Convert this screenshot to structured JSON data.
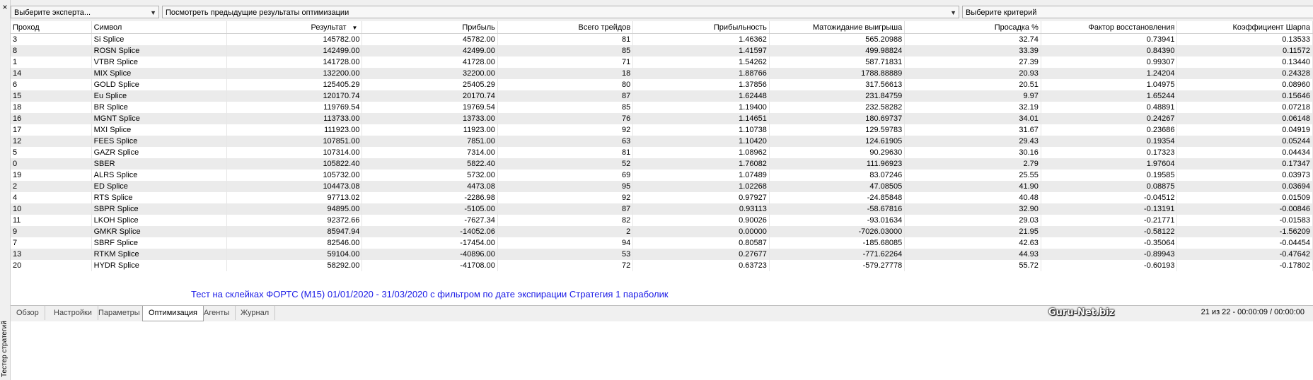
{
  "left_panel": {
    "close": "×",
    "title": "Тестер стратегий"
  },
  "toolbar": {
    "expert_select": "Выберите эксперта...",
    "prev_results_select": "Посмотреть предыдущие результаты оптимизации",
    "criterion_select": "Выберите критерий"
  },
  "table": {
    "columns": [
      "Проход",
      "Символ",
      "Результат",
      "Прибыль",
      "Всего трейдов",
      "Прибыльность",
      "Матожидание выигрыша",
      "Просадка %",
      "Фактор восстановления",
      "Коэффициент Шарпа"
    ],
    "rows": [
      [
        "3",
        "Si Splice",
        "145782.00",
        "45782.00",
        "81",
        "1.46362",
        "565.20988",
        "32.74",
        "0.73941",
        "0.13533"
      ],
      [
        "8",
        "ROSN Splice",
        "142499.00",
        "42499.00",
        "85",
        "1.41597",
        "499.98824",
        "33.39",
        "0.84390",
        "0.11572"
      ],
      [
        "1",
        "VTBR Splice",
        "141728.00",
        "41728.00",
        "71",
        "1.54262",
        "587.71831",
        "27.39",
        "0.99307",
        "0.13440"
      ],
      [
        "14",
        "MIX Splice",
        "132200.00",
        "32200.00",
        "18",
        "1.88766",
        "1788.88889",
        "20.93",
        "1.24204",
        "0.24328"
      ],
      [
        "6",
        "GOLD Splice",
        "125405.29",
        "25405.29",
        "80",
        "1.37856",
        "317.56613",
        "20.51",
        "1.04975",
        "0.08960"
      ],
      [
        "15",
        "Eu Splice",
        "120170.74",
        "20170.74",
        "87",
        "1.62448",
        "231.84759",
        "9.97",
        "1.65244",
        "0.15646"
      ],
      [
        "18",
        "BR Splice",
        "119769.54",
        "19769.54",
        "85",
        "1.19400",
        "232.58282",
        "32.19",
        "0.48891",
        "0.07218"
      ],
      [
        "16",
        "MGNT Splice",
        "113733.00",
        "13733.00",
        "76",
        "1.14651",
        "180.69737",
        "34.01",
        "0.24267",
        "0.06148"
      ],
      [
        "17",
        "MXI Splice",
        "111923.00",
        "11923.00",
        "92",
        "1.10738",
        "129.59783",
        "31.67",
        "0.23686",
        "0.04919"
      ],
      [
        "12",
        "FEES Splice",
        "107851.00",
        "7851.00",
        "63",
        "1.10420",
        "124.61905",
        "29.43",
        "0.19354",
        "0.05244"
      ],
      [
        "5",
        "GAZR Splice",
        "107314.00",
        "7314.00",
        "81",
        "1.08962",
        "90.29630",
        "30.16",
        "0.17323",
        "0.04434"
      ],
      [
        "0",
        "SBER",
        "105822.40",
        "5822.40",
        "52",
        "1.76082",
        "111.96923",
        "2.79",
        "1.97604",
        "0.17347"
      ],
      [
        "19",
        "ALRS Splice",
        "105732.00",
        "5732.00",
        "69",
        "1.07489",
        "83.07246",
        "25.55",
        "0.19585",
        "0.03973"
      ],
      [
        "2",
        "ED Splice",
        "104473.08",
        "4473.08",
        "95",
        "1.02268",
        "47.08505",
        "41.90",
        "0.08875",
        "0.03694"
      ],
      [
        "4",
        "RTS Splice",
        "97713.02",
        "-2286.98",
        "92",
        "0.97927",
        "-24.85848",
        "40.48",
        "-0.04512",
        "0.01509"
      ],
      [
        "10",
        "SBPR Splice",
        "94895.00",
        "-5105.00",
        "87",
        "0.93113",
        "-58.67816",
        "32.90",
        "-0.13191",
        "-0.00846"
      ],
      [
        "11",
        "LKOH Splice",
        "92372.66",
        "-7627.34",
        "82",
        "0.90026",
        "-93.01634",
        "29.03",
        "-0.21771",
        "-0.01583"
      ],
      [
        "9",
        "GMKR Splice",
        "85947.94",
        "-14052.06",
        "2",
        "0.00000",
        "-7026.03000",
        "21.95",
        "-0.58122",
        "-1.56209"
      ],
      [
        "7",
        "SBRF Splice",
        "82546.00",
        "-17454.00",
        "94",
        "0.80587",
        "-185.68085",
        "42.63",
        "-0.35064",
        "-0.04454"
      ],
      [
        "13",
        "RTKM Splice",
        "59104.00",
        "-40896.00",
        "53",
        "0.27677",
        "-771.62264",
        "44.93",
        "-0.89943",
        "-0.47642"
      ],
      [
        "20",
        "HYDR Splice",
        "58292.00",
        "-41708.00",
        "72",
        "0.63723",
        "-579.27778",
        "55.72",
        "-0.60193",
        "-0.17802"
      ]
    ]
  },
  "caption": "Тест на склейках ФОРТС (M15) 01/01/2020 - 31/03/2020  с фильтром по дате экспирации   Стратегия 1 параболик",
  "tabs": [
    "Обзор",
    "Настройки",
    "Параметры",
    "Оптимизация",
    "Агенты",
    "Журнал"
  ],
  "active_tab": "Оптимизация",
  "status": "21 из 22 - 00:00:09 / 00:00:00",
  "watermark": "Guru-Net.biz"
}
